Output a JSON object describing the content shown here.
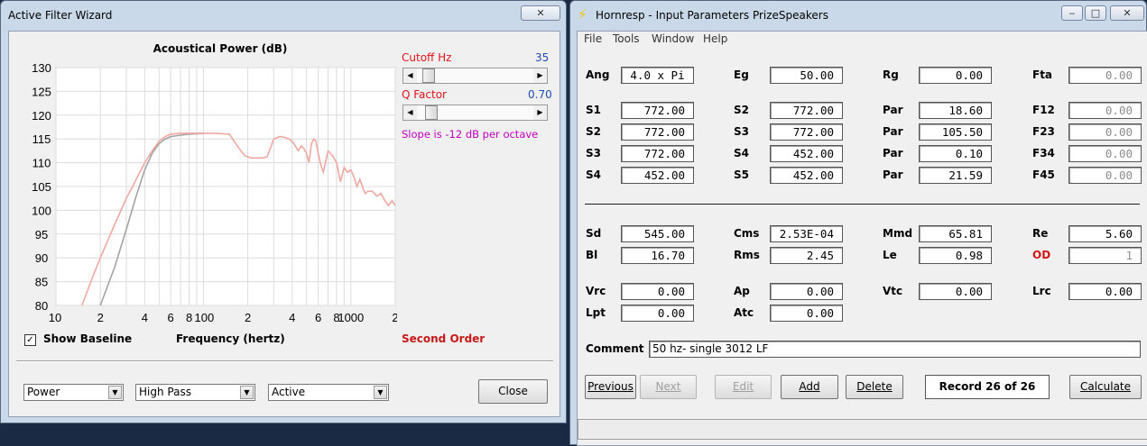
{
  "filter_window": {
    "title": "Active Filter Wizard",
    "close_glyph": "✕",
    "chart": {
      "title": "Acoustical Power (dB)",
      "xlabel": "Frequency (hertz)",
      "y_ticks": [
        "130",
        "125",
        "120",
        "115",
        "110",
        "105",
        "100",
        "95",
        "90",
        "85",
        "80"
      ],
      "x_ticks": [
        "10",
        "2",
        "4",
        "6",
        "8",
        "100",
        "2",
        "4",
        "6",
        "8",
        "1000",
        "2"
      ]
    },
    "cutoff_label": "Cutoff  Hz",
    "cutoff_value": "35",
    "cutoff_fraction": 0.05,
    "q_label": "Q Factor",
    "q_value": "0.70",
    "q_fraction": 0.08,
    "slope_text": "Slope is -12 dB per octave",
    "baseline_checkbox_mark": "✓",
    "baseline_label": "Show Baseline",
    "order_text": "Second Order",
    "dropdowns": [
      {
        "value": "Power"
      },
      {
        "value": "High Pass"
      },
      {
        "value": "Active"
      }
    ],
    "close_button": "Close"
  },
  "chart_data": {
    "type": "line",
    "title": "Acoustical Power (dB)",
    "xlabel": "Frequency (hertz)",
    "ylabel": "",
    "x_scale": "log",
    "xlim": [
      10,
      2000
    ],
    "ylim": [
      80,
      130
    ],
    "grid": true,
    "colors": {
      "baseline": "#a3a3a3",
      "filtered": "#f0a8a0"
    },
    "series": [
      {
        "x": [
          15,
          18,
          20,
          25,
          30,
          35,
          40,
          45,
          50,
          55,
          60,
          70,
          80,
          100,
          120,
          150,
          170,
          190,
          210,
          230,
          250,
          270,
          300,
          330,
          360,
          380,
          400,
          420,
          440,
          460,
          480,
          500,
          520,
          540,
          560,
          580,
          600,
          620,
          650,
          700,
          750,
          800,
          850,
          900,
          950,
          1000,
          1050,
          1100,
          1150,
          1200,
          1250,
          1300,
          1400,
          1500,
          1600,
          1700,
          1800,
          1900,
          2000
        ],
        "values": [
          80,
          86.5,
          90,
          97,
          102.5,
          106.5,
          110,
          112.5,
          114.5,
          115.5,
          116,
          116.2,
          116.2,
          116.2,
          116.2,
          116,
          113.5,
          111.5,
          111,
          111,
          111,
          111.2,
          115,
          115.5,
          115.3,
          115,
          114.5,
          113.5,
          112.5,
          113.5,
          113,
          112,
          110,
          114,
          115,
          114.5,
          112,
          110,
          108,
          112.5,
          111.5,
          110,
          106,
          109,
          108,
          108.5,
          107,
          105,
          106.5,
          105,
          103.5,
          104,
          104,
          103,
          103.5,
          102,
          101,
          102,
          101
        ]
      },
      {
        "x": [
          20,
          25,
          30,
          35,
          40,
          45,
          50,
          55,
          60,
          70,
          80,
          100
        ],
        "values": [
          80,
          88,
          96,
          103,
          108.5,
          112,
          114,
          115,
          115.5,
          115.8,
          116,
          116.2
        ]
      }
    ]
  },
  "hornresp_window": {
    "title": "Hornresp - Input Parameters  PrizeSpeakers",
    "logo_glyph": "⚡",
    "controls": {
      "minimize": "‒",
      "restore": "□",
      "close": "✕"
    },
    "menu": [
      "File",
      "Tools",
      "Window",
      "Help"
    ],
    "params_top": [
      {
        "label": "Ang",
        "value": "4.0 x Pi"
      },
      {
        "label": "Eg",
        "value": "50.00"
      },
      {
        "label": "Rg",
        "value": "0.00"
      },
      {
        "label": "Fta",
        "value": "0.00"
      },
      {
        "label": "S1",
        "value": "772.00"
      },
      {
        "label": "S2",
        "value": "772.00"
      },
      {
        "label": "Par",
        "value": "18.60"
      },
      {
        "label": "F12",
        "value": "0.00"
      },
      {
        "label": "S2",
        "value": "772.00"
      },
      {
        "label": "S3",
        "value": "772.00"
      },
      {
        "label": "Par",
        "value": "105.50"
      },
      {
        "label": "F23",
        "value": "0.00"
      },
      {
        "label": "S3",
        "value": "772.00"
      },
      {
        "label": "S4",
        "value": "452.00"
      },
      {
        "label": "Par",
        "value": "0.10"
      },
      {
        "label": "F34",
        "value": "0.00"
      },
      {
        "label": "S4",
        "value": "452.00"
      },
      {
        "label": "S5",
        "value": "452.00"
      },
      {
        "label": "Par",
        "value": "21.59"
      },
      {
        "label": "F45",
        "value": "0.00"
      }
    ],
    "params_bottom": [
      {
        "label": "Sd",
        "value": "545.00"
      },
      {
        "label": "Cms",
        "value": "2.53E-04"
      },
      {
        "label": "Mmd",
        "value": "65.81"
      },
      {
        "label": "Re",
        "value": "5.60"
      },
      {
        "label": "Bl",
        "value": "16.70"
      },
      {
        "label": "Rms",
        "value": "2.45"
      },
      {
        "label": "Le",
        "value": "0.98"
      },
      {
        "label": "OD",
        "value": "1"
      },
      {
        "label": "Vrc",
        "value": "0.00"
      },
      {
        "label": "Ap",
        "value": "0.00"
      },
      {
        "label": "Vtc",
        "value": "0.00"
      },
      {
        "label": "Lrc",
        "value": "0.00"
      },
      {
        "label": "Lpt",
        "value": "0.00"
      },
      {
        "label": "Atc",
        "value": "0.00"
      }
    ],
    "comment_label": "Comment",
    "comment_value": "50 hz- single 3012 LF",
    "buttons": {
      "previous": "Previous",
      "next": "Next",
      "edit": "Edit",
      "add": "Add",
      "delete": "Delete",
      "calculate": "Calculate"
    },
    "record_text": "Record 26 of 26"
  }
}
